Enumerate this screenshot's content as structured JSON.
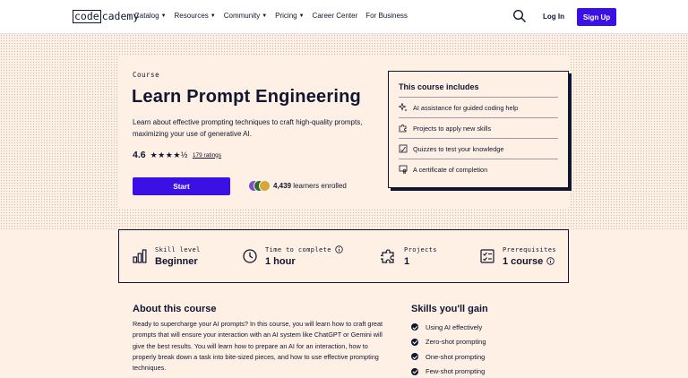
{
  "nav": {
    "logo_code": "code",
    "logo_rest": "cademy",
    "links": [
      {
        "label": "Catalog",
        "dropdown": true
      },
      {
        "label": "Resources",
        "dropdown": true
      },
      {
        "label": "Community",
        "dropdown": true
      },
      {
        "label": "Pricing",
        "dropdown": true
      },
      {
        "label": "Career Center",
        "dropdown": false
      },
      {
        "label": "For Business",
        "dropdown": false
      }
    ],
    "login": "Log In",
    "signup": "Sign Up"
  },
  "hero": {
    "eyebrow": "Course",
    "title": "Learn Prompt Engineering",
    "description": "Learn about effective prompting techniques to craft high-quality prompts, maximizing your use of generative AI.",
    "rating": "4.6",
    "stars": "★★★★½",
    "ratings_count": "179 ratings",
    "start_label": "Start",
    "learners_count": "4,439",
    "learners_text": "learners enrolled"
  },
  "includes": {
    "title": "This course includes",
    "items": [
      {
        "label": "AI assistance for guided coding help",
        "icon": "sparkle-icon"
      },
      {
        "label": "Projects to apply new skills",
        "icon": "puzzle-icon"
      },
      {
        "label": "Quizzes to test your knowledge",
        "icon": "quiz-icon"
      },
      {
        "label": "A certificate of completion",
        "icon": "certificate-icon"
      }
    ]
  },
  "stats": {
    "skill_label": "Skill level",
    "skill_value": "Beginner",
    "time_label": "Time to complete",
    "time_value": "1 hour",
    "projects_label": "Projects",
    "projects_value": "1",
    "prereq_label": "Prerequisites",
    "prereq_value": "1 course"
  },
  "about": {
    "heading": "About this course",
    "text": "Ready to supercharge your AI prompts? In this course, you will learn how to craft great prompts that will ensure your interaction with an AI system like ChatGPT or Gemini will give the best results. You will learn how to prepare an AI for an interaction, how to properly break down a task into bite-sized pieces, and how to use effective prompting techniques."
  },
  "skills": {
    "heading": "Skills you'll gain",
    "items": [
      "Using AI effectively",
      "Zero-shot prompting",
      "One-shot prompting",
      "Few-shot prompting"
    ]
  },
  "colors": {
    "brand": "#3a10e5",
    "navy": "#10162f",
    "cream": "#fff0e5"
  }
}
